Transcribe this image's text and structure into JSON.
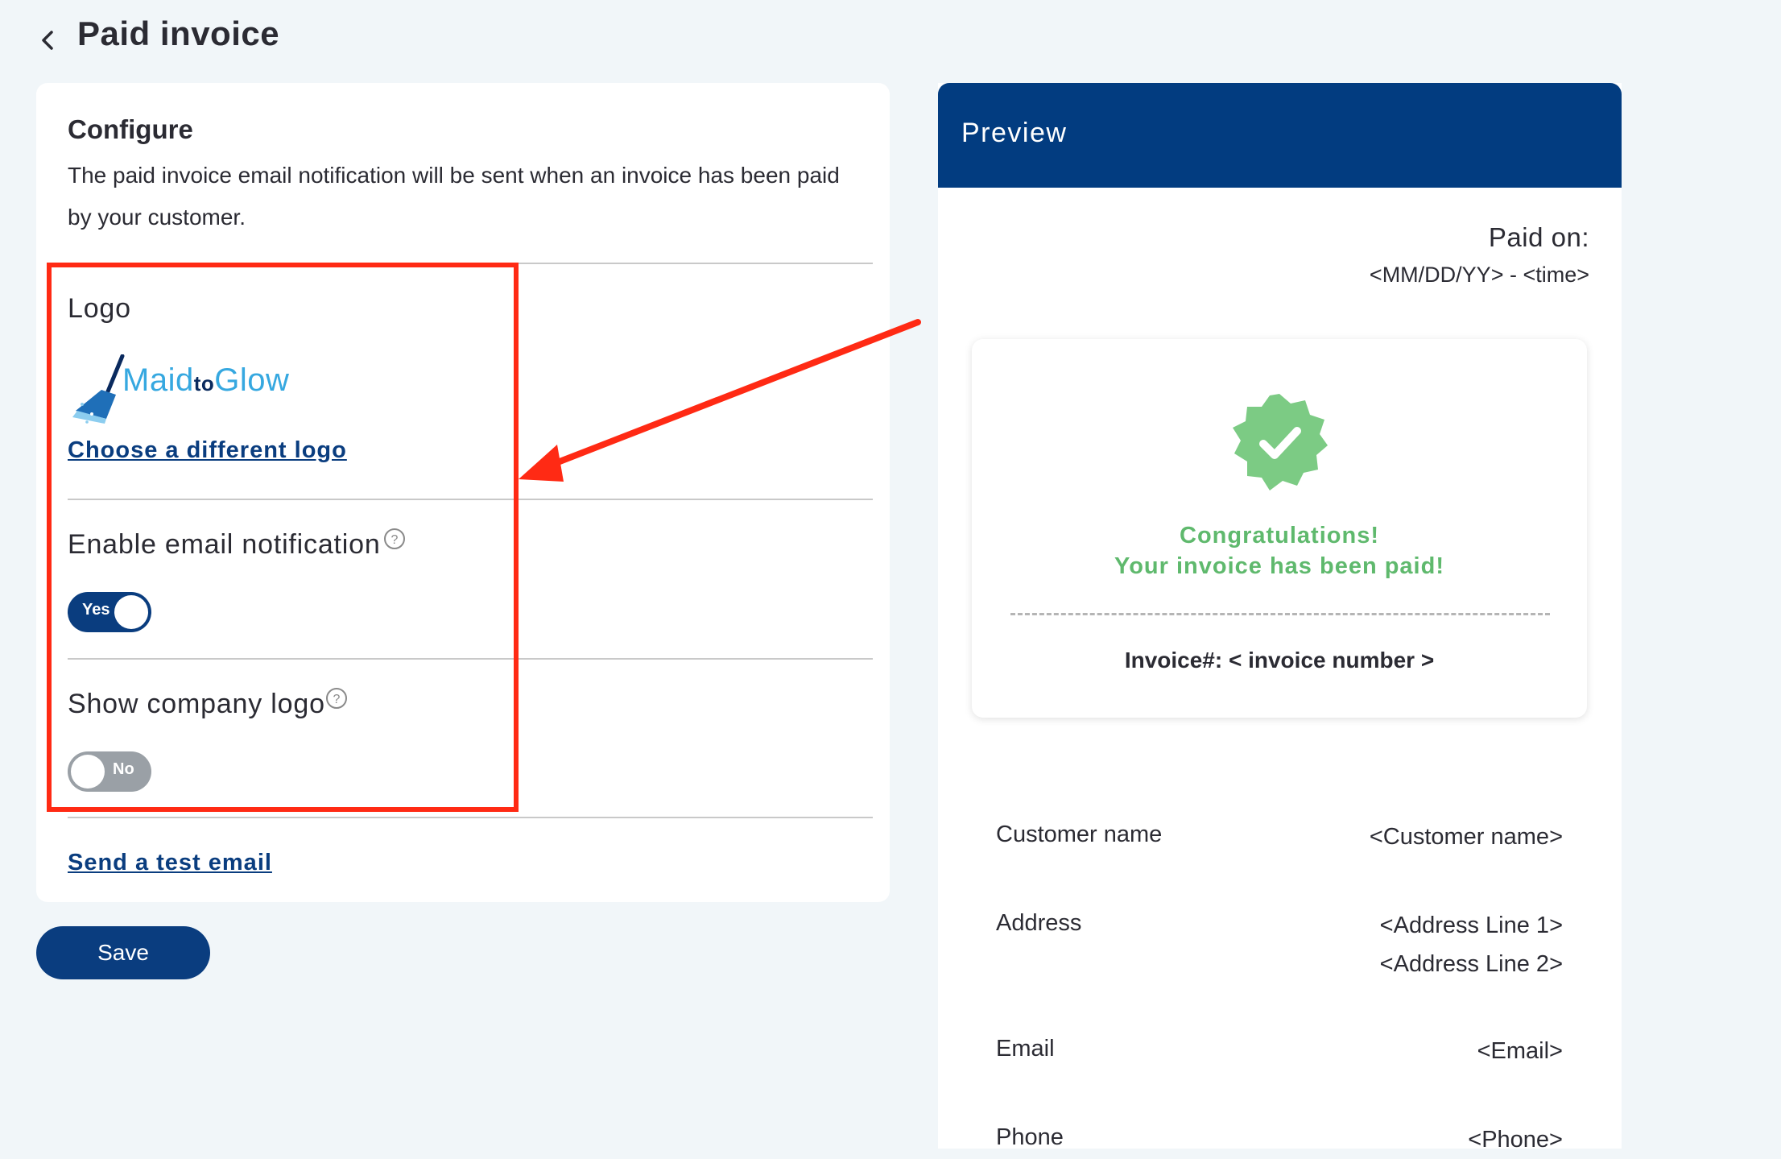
{
  "header": {
    "title": "Paid invoice",
    "back_icon": "chevron-left-icon"
  },
  "configure": {
    "heading": "Configure",
    "description": "The paid invoice email notification will be sent when an invoice has been paid by your customer.",
    "logo": {
      "label": "Logo",
      "brand_main": "Maid",
      "brand_small": "to",
      "brand_end": "Glow",
      "choose_link": "Choose a different logo"
    },
    "enable_email": {
      "label": "Enable email notification",
      "toggle_label": "Yes",
      "value": true
    },
    "show_logo": {
      "label": "Show company logo",
      "toggle_label": "No",
      "value": false
    },
    "test_email_link": "Send a test email"
  },
  "save_label": "Save",
  "preview": {
    "title": "Preview",
    "paid_on_label": "Paid on:",
    "paid_on_value": "<MM/DD/YY> - <time>",
    "congrats_line1": "Congratulations!",
    "congrats_line2": "Your invoice has been paid!",
    "invoice_number": "Invoice#: < invoice number >",
    "fields": {
      "customer_label": "Customer name",
      "customer_value": "<Customer name>",
      "address_label": "Address",
      "address_line1": "<Address Line 1>",
      "address_line2": "<Address Line 2>",
      "email_label": "Email",
      "email_value": "<Email>",
      "phone_label": "Phone",
      "phone_value": "<Phone>"
    }
  },
  "colors": {
    "brand_navy": "#0a3d7f",
    "preview_header": "#023c80",
    "success_green": "#5fb96d",
    "highlight_red": "#ff2a14",
    "background": "#f1f6f9"
  }
}
